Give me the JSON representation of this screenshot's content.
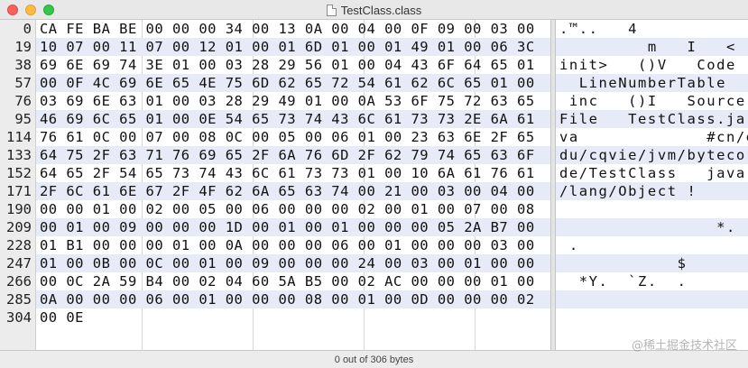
{
  "window": {
    "title": "TestClass.class",
    "status": "0 out of 306 bytes",
    "watermark": "@稀土掘金技术社区"
  },
  "rows": [
    {
      "offset": "0",
      "hex": "CA FE BA BE 00 00 00 34 00 13 0A 00 04 00 0F 09 00 03 00",
      "ascii": ".™..   4"
    },
    {
      "offset": "19",
      "hex": "10 07 00 11 07 00 12 01 00 01 6D 01 00 01 49 01 00 06 3C",
      "ascii": "         m   I   <"
    },
    {
      "offset": "38",
      "hex": "69 6E 69 74 3E 01 00 03 28 29 56 01 00 04 43 6F 64 65 01",
      "ascii": "init>   ()V   Code"
    },
    {
      "offset": "57",
      "hex": "00 0F 4C 69 6E 65 4E 75 6D 62 65 72 54 61 62 6C 65 01 00",
      "ascii": "  LineNumberTable"
    },
    {
      "offset": "76",
      "hex": "03 69 6E 63 01 00 03 28 29 49 01 00 0A 53 6F 75 72 63 65",
      "ascii": " inc   ()I   Source"
    },
    {
      "offset": "95",
      "hex": "46 69 6C 65 01 00 0E 54 65 73 74 43 6C 61 73 73 2E 6A 61",
      "ascii": "File   TestClass.ja"
    },
    {
      "offset": "114",
      "hex": "76 61 0C 00 07 00 08 0C 00 05 00 06 01 00 23 63 6E 2F 65",
      "ascii": "va             #cn/e"
    },
    {
      "offset": "133",
      "hex": "64 75 2F 63 71 76 69 65 2F 6A 76 6D 2F 62 79 74 65 63 6F",
      "ascii": "du/cqvie/jvm/byteco"
    },
    {
      "offset": "152",
      "hex": "64 65 2F 54 65 73 74 43 6C 61 73 73 01 00 10 6A 61 76 61",
      "ascii": "de/TestClass   java"
    },
    {
      "offset": "171",
      "hex": "2F 6C 61 6E 67 2F 4F 62 6A 65 63 74 00 21 00 03 00 04 00",
      "ascii": "/lang/Object !"
    },
    {
      "offset": "190",
      "hex": "00 00 01 00 02 00 05 00 06 00 00 00 02 00 01 00 07 00 08",
      "ascii": ""
    },
    {
      "offset": "209",
      "hex": "00 01 00 09 00 00 00 1D 00 01 00 01 00 00 00 05 2A B7 00",
      "ascii": "                *."
    },
    {
      "offset": "228",
      "hex": "01 B1 00 00 00 01 00 0A 00 00 00 06 00 01 00 00 00 03 00",
      "ascii": " ."
    },
    {
      "offset": "247",
      "hex": "01 00 0B 00 0C 00 01 00 09 00 00 00 24 00 03 00 01 00 00",
      "ascii": "            $"
    },
    {
      "offset": "266",
      "hex": "00 0C 2A 59 B4 00 02 04 60 5A B5 00 02 AC 00 00 00 01 00",
      "ascii": "  *Y.  `Z.  ."
    },
    {
      "offset": "285",
      "hex": "0A 00 00 00 06 00 01 00 00 00 08 00 01 00 0D 00 00 00 02",
      "ascii": ""
    },
    {
      "offset": "304",
      "hex": "00 0E",
      "ascii": ""
    }
  ]
}
